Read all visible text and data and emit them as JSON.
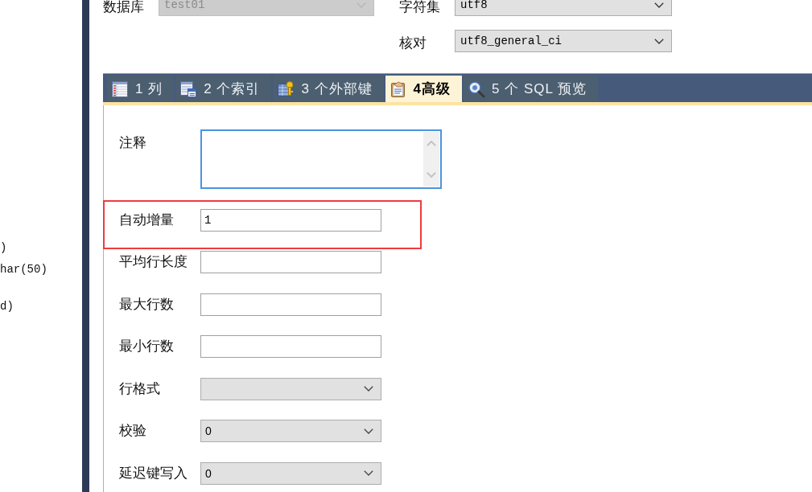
{
  "left_panel": {
    "lines": [
      ")",
      "har(50)",
      "d)"
    ]
  },
  "header_fields": [
    {
      "label": "数据库",
      "value": "test01",
      "disabled": true
    },
    {
      "label": "字符集",
      "value": "utf8",
      "disabled": false
    },
    {
      "label": "核对",
      "value": "utf8_general_ci",
      "disabled": false
    }
  ],
  "tabs": [
    {
      "label": "1 列",
      "selected": false
    },
    {
      "label": "2 个索引",
      "selected": false
    },
    {
      "label": "3 个外部键",
      "selected": false
    },
    {
      "label": "4高级",
      "selected": true
    },
    {
      "label": "5 个 SQL 预览",
      "selected": false
    }
  ],
  "advanced_fields": [
    {
      "kind": "textarea",
      "label": "注释",
      "highlighted": false
    },
    {
      "kind": "text",
      "label": "自动增量",
      "value": "1",
      "highlighted": true
    },
    {
      "kind": "text",
      "label": "平均行长度",
      "highlighted": false
    },
    {
      "kind": "text",
      "label": "最大行数",
      "highlighted": false
    },
    {
      "kind": "text",
      "label": "最小行数",
      "highlighted": false
    },
    {
      "kind": "select",
      "label": "行格式",
      "highlighted": false
    },
    {
      "kind": "select",
      "label": "校验",
      "value": "0",
      "highlighted": false
    },
    {
      "kind": "select",
      "label": "延迟键写入",
      "value": "0",
      "highlighted": false
    }
  ]
}
